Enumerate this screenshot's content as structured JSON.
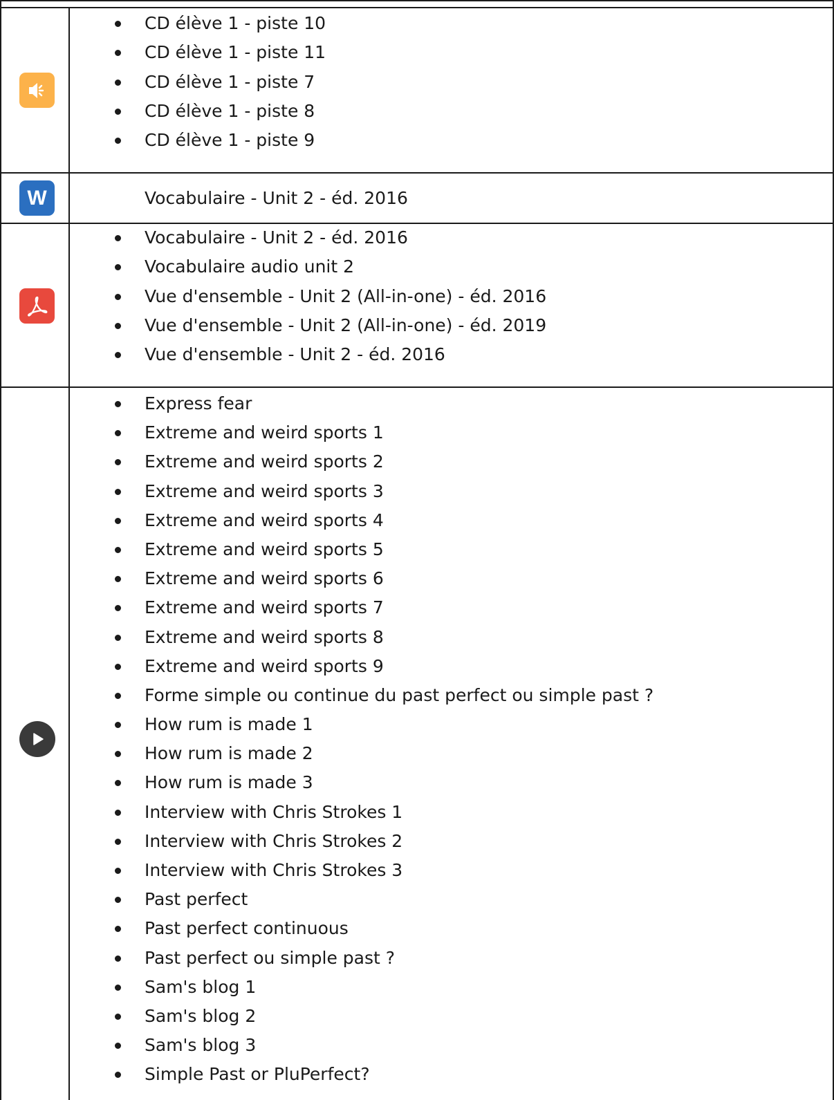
{
  "rows": {
    "audio": {
      "icon": "speaker-icon",
      "color": "#fcb24a",
      "items": [
        "CD élève 1 - piste 10",
        "CD élève 1 - piste 11",
        "CD élève 1 - piste 7",
        "CD élève 1 - piste 8",
        "CD élève 1 - piste 9"
      ]
    },
    "word": {
      "icon": "word-document-icon",
      "icon_letter": "W",
      "color": "#2b6fc0",
      "item": "Vocabulaire - Unit 2 - éd. 2016"
    },
    "pdf": {
      "icon": "pdf-icon",
      "color": "#e8493d",
      "items": [
        "Vocabulaire - Unit 2 - éd. 2016",
        "Vocabulaire audio unit 2",
        "Vue d'ensemble - Unit 2 (All-in-one) - éd. 2016",
        "Vue d'ensemble - Unit 2 (All-in-one) - éd. 2019",
        "Vue d'ensemble - Unit 2 - éd. 2016"
      ]
    },
    "video": {
      "icon": "play-icon",
      "color": "#3a3a3a",
      "items": [
        "Express fear",
        "Extreme and weird sports 1",
        "Extreme and weird sports 2",
        "Extreme and weird sports 3",
        "Extreme and weird sports 4",
        "Extreme and weird sports 5",
        "Extreme and weird sports 6",
        "Extreme and weird sports 7",
        "Extreme and weird sports 8",
        "Extreme and weird sports 9",
        "Forme simple ou continue du past perfect ou simple past ?",
        "How rum is made 1",
        "How rum is made 2",
        "How rum is made 3",
        "Interview with Chris Strokes 1",
        "Interview with Chris Strokes 2",
        "Interview with Chris Strokes 3",
        "Past perfect",
        "Past perfect continuous",
        "Past perfect ou simple past ?",
        "Sam's blog 1",
        "Sam's blog 2",
        "Sam's blog 3",
        "Simple Past or PluPerfect?"
      ]
    }
  }
}
